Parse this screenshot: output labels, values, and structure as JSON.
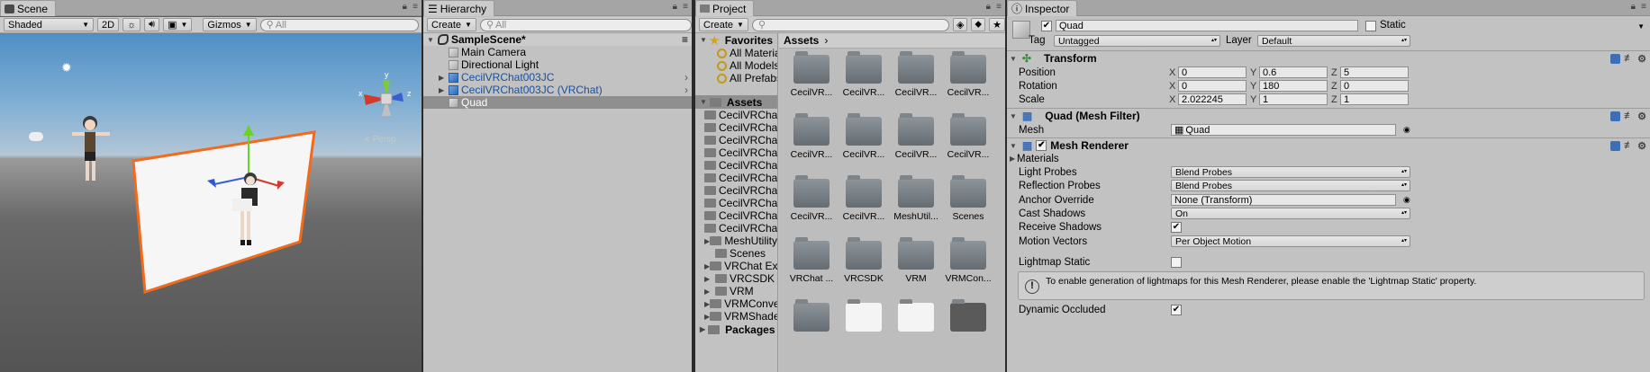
{
  "scene": {
    "tab": "Scene",
    "shading": "Shaded",
    "mode2d": "2D",
    "gizmos": "Gizmos",
    "search_placeholder": "All",
    "camera_label": "< Persp",
    "gizmo_x": "x",
    "gizmo_y": "y",
    "gizmo_z": "z"
  },
  "hierarchy": {
    "tab": "Hierarchy",
    "create": "Create",
    "search_placeholder": "All",
    "scene_name": "SampleScene*",
    "items": [
      {
        "label": "Main Camera"
      },
      {
        "label": "Directional Light"
      },
      {
        "label": "CecilVRChat003JC"
      },
      {
        "label": "CecilVRChat003JC (VRChat)"
      },
      {
        "label": "Quad"
      }
    ]
  },
  "project": {
    "tab": "Project",
    "create": "Create",
    "favorites": "Favorites",
    "fav_items": [
      "All Materials",
      "All Models",
      "All Prefabs"
    ],
    "assets_root": "Assets",
    "asset_folders": [
      "CecilVRChat",
      "CecilVRChat",
      "CecilVRChat",
      "CecilVRChat",
      "CecilVRChat",
      "CecilVRChat",
      "CecilVRChat",
      "CecilVRChat",
      "CecilVRChat",
      "CecilVRChat",
      "MeshUtility",
      "Scenes",
      "VRChat Examples",
      "VRCSDK",
      "VRM",
      "VRMConverter",
      "VRMShaders"
    ],
    "packages": "Packages",
    "breadcrumb": "Assets",
    "grid_items": [
      "CecilVR...",
      "CecilVR...",
      "CecilVR...",
      "CecilVR...",
      "CecilVR...",
      "CecilVR...",
      "CecilVR...",
      "CecilVR...",
      "CecilVR...",
      "CecilVR...",
      "MeshUtil...",
      "Scenes",
      "VRChat ...",
      "VRCSDK",
      "VRM",
      "VRMCon..."
    ]
  },
  "inspector": {
    "tab": "Inspector",
    "object_name": "Quad",
    "static_label": "Static",
    "tag_label": "Tag",
    "tag_value": "Untagged",
    "layer_label": "Layer",
    "layer_value": "Default",
    "transform": {
      "title": "Transform",
      "position_label": "Position",
      "position": {
        "x": "0",
        "y": "0.6",
        "z": "5"
      },
      "rotation_label": "Rotation",
      "rotation": {
        "x": "0",
        "y": "180",
        "z": "0"
      },
      "scale_label": "Scale",
      "scale": {
        "x": "2.022245",
        "y": "1",
        "z": "1"
      },
      "axis_x": "X",
      "axis_y": "Y",
      "axis_z": "Z"
    },
    "mesh_filter": {
      "title": "Quad (Mesh Filter)",
      "mesh_label": "Mesh",
      "mesh_value": "Quad"
    },
    "mesh_renderer": {
      "title": "Mesh Renderer",
      "materials": "Materials",
      "light_probes_label": "Light Probes",
      "light_probes": "Blend Probes",
      "reflection_probes_label": "Reflection Probes",
      "reflection_probes": "Blend Probes",
      "anchor_override_label": "Anchor Override",
      "anchor_override": "None (Transform)",
      "cast_shadows_label": "Cast Shadows",
      "cast_shadows": "On",
      "receive_shadows_label": "Receive Shadows",
      "motion_vectors_label": "Motion Vectors",
      "motion_vectors": "Per Object Motion",
      "lightmap_static_label": "Lightmap Static",
      "lightmap_note": "To enable generation of lightmaps for this Mesh Renderer, please enable the 'Lightmap Static' property.",
      "dynamic_occluded_label": "Dynamic Occluded"
    }
  },
  "colors": {
    "selection": "#8f8f8f",
    "prefab_text": "#1a4f9c",
    "quad_outline": "#f26a1b",
    "accent_blue": "#3d6fb6"
  }
}
